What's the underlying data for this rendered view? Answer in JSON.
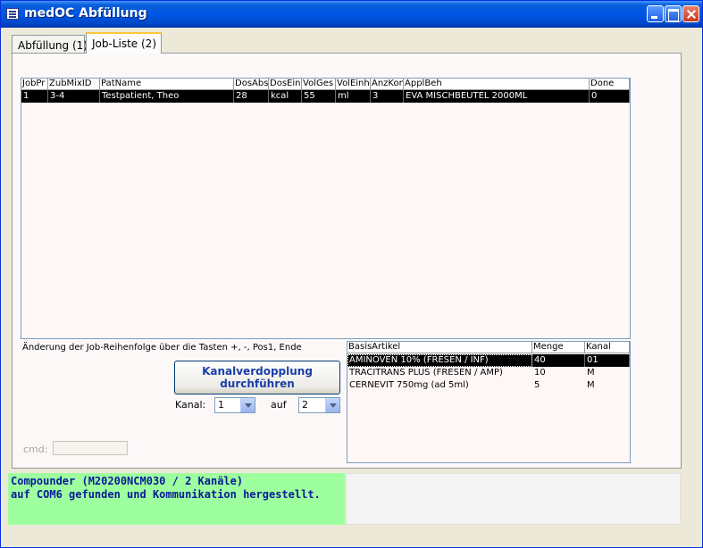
{
  "window": {
    "title": "medOC Abfüllung"
  },
  "tabs": [
    {
      "label": "Abfüllung (1)",
      "active": false
    },
    {
      "label": "Job-Liste (2)",
      "active": true
    }
  ],
  "job_table": {
    "columns": [
      "JobPr",
      "ZubMixID",
      "PatName",
      "DosAbs",
      "DosEinh",
      "VolGes",
      "VolEinh",
      "AnzKom",
      "ApplBeh",
      "Done"
    ],
    "rows": [
      [
        "1",
        "3-4",
        "Testpatient, Theo",
        "28",
        "kcal",
        "55",
        "ml",
        "3",
        "EVA MISCHBEUTEL 2000ML",
        "0"
      ]
    ]
  },
  "hint": "Änderung der Job-Reihenfolge über die Tasten  +,  -,  Pos1,  Ende",
  "channel_button": {
    "line1": "Kanalverdopplung",
    "line2": "durchführen"
  },
  "channel": {
    "label_from": "Kanal:",
    "from_value": "1",
    "label_to": "auf",
    "to_value": "2"
  },
  "cmd": {
    "label": "cmd:",
    "value": ""
  },
  "article_table": {
    "columns": [
      "BasisArtikel",
      "Menge",
      "Kanal"
    ],
    "rows": [
      [
        "AMINOVEN 10% (FRESEN / INF)",
        "40",
        "01"
      ],
      [
        "TRACITRANS PLUS (FRESEN / AMP)",
        "10",
        "M"
      ],
      [
        "CERNEVIT 750mg (ad 5ml)",
        "5",
        "M"
      ]
    ]
  },
  "status": {
    "line1": "Compounder (M20200NCM030  / 2 Kanäle)",
    "line2": "auf COM6 gefunden und Kommunikation hergestellt."
  },
  "colors": {
    "title_bar": "#0055e5",
    "selection": "#000000",
    "status_ok": "#9eff9e",
    "status_text": "#0a1a9a"
  }
}
